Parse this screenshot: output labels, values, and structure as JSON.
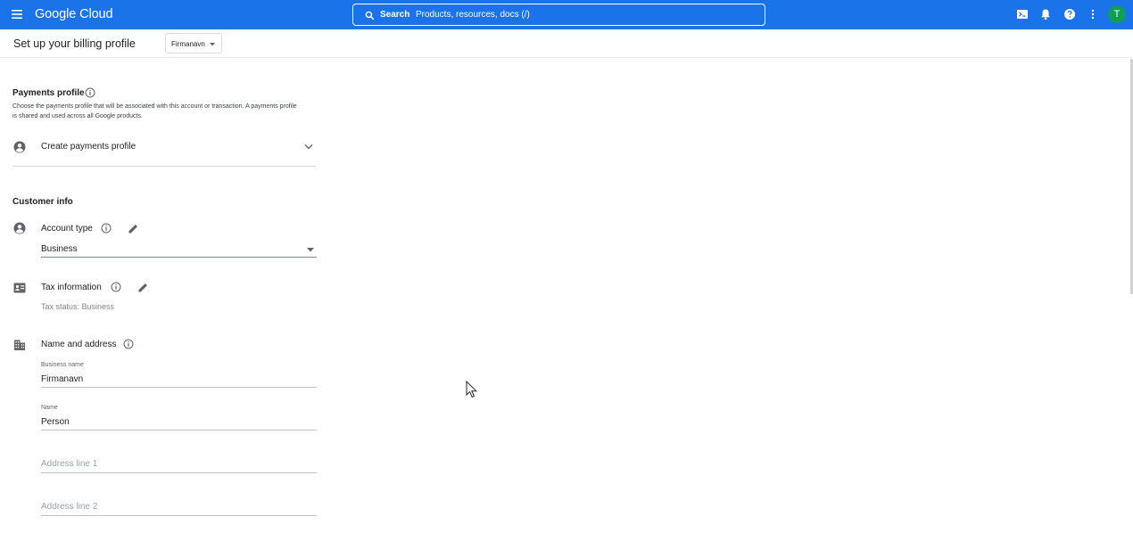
{
  "topbar": {
    "logo": "Google Cloud",
    "search_label": "Search",
    "search_placeholder": "Products, resources, docs (/)",
    "avatar_letter": "T",
    "colors": {
      "bar": "#1a73e8",
      "avatar": "#0f9d58"
    }
  },
  "page": {
    "title": "Set up your billing profile",
    "project": "Firmanavn"
  },
  "payments_profile": {
    "title": "Payments profile",
    "description": "Choose the payments profile that will be associated with this account or transaction. A payments profile is shared and used across all Google products.",
    "option": "Create payments profile"
  },
  "customer_info": {
    "title": "Customer info",
    "account_type": {
      "label": "Account type",
      "value": "Business"
    },
    "tax_information": {
      "label": "Tax information",
      "status": "Tax status: Business"
    },
    "name_and_address": {
      "label": "Name and address",
      "business_name": {
        "label": "Business name",
        "value": "Firmanavn"
      },
      "name": {
        "label": "Name",
        "value": "Person"
      },
      "address_line_1": {
        "placeholder": "Address line 1"
      },
      "address_line_2": {
        "placeholder": "Address line 2"
      }
    }
  }
}
